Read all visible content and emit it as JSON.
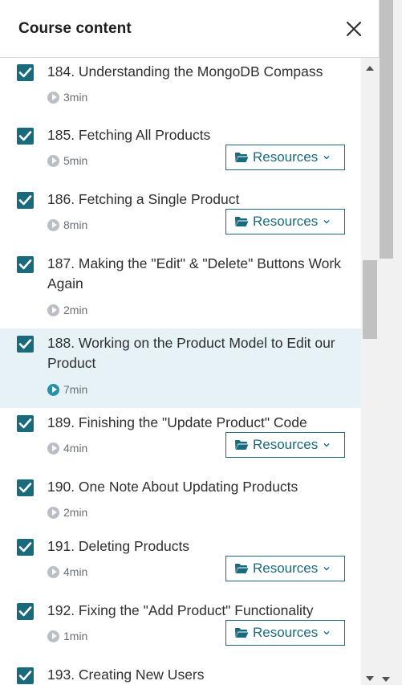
{
  "header": {
    "title": "Course content"
  },
  "icons": {
    "close": "close-icon",
    "check": "check-icon",
    "play": "play-circle-icon",
    "folder": "folder-open-icon",
    "chevron": "chevron-down-icon"
  },
  "colors": {
    "accent": "#1a6a7d",
    "active_bg": "#e6f2f5",
    "play_active": "#2a8fa8"
  },
  "lectures": [
    {
      "title": "184. Understanding the MongoDB Compass",
      "duration": "3min",
      "completed": true,
      "resources": false,
      "active": false
    },
    {
      "title": "185. Fetching All Products",
      "duration": "5min",
      "completed": true,
      "resources": true,
      "active": false
    },
    {
      "title": "186. Fetching a Single Product",
      "duration": "8min",
      "completed": true,
      "resources": true,
      "active": false
    },
    {
      "title": "187. Making the \"Edit\" & \"Delete\" Buttons Work Again",
      "duration": "2min",
      "completed": true,
      "resources": false,
      "active": false
    },
    {
      "title": "188. Working on the Product Model to Edit our Product",
      "duration": "7min",
      "completed": true,
      "resources": false,
      "active": true
    },
    {
      "title": "189. Finishing the \"Update Product\" Code",
      "duration": "4min",
      "completed": true,
      "resources": true,
      "active": false
    },
    {
      "title": "190. One Note About Updating Products",
      "duration": "2min",
      "completed": true,
      "resources": false,
      "active": false
    },
    {
      "title": "191. Deleting Products",
      "duration": "4min",
      "completed": true,
      "resources": true,
      "active": false
    },
    {
      "title": "192. Fixing the \"Add Product\" Functionality",
      "duration": "1min",
      "completed": true,
      "resources": true,
      "active": false
    },
    {
      "title": "193. Creating New Users",
      "duration": "",
      "completed": true,
      "resources": false,
      "active": false
    }
  ],
  "resources_label": "Resources"
}
